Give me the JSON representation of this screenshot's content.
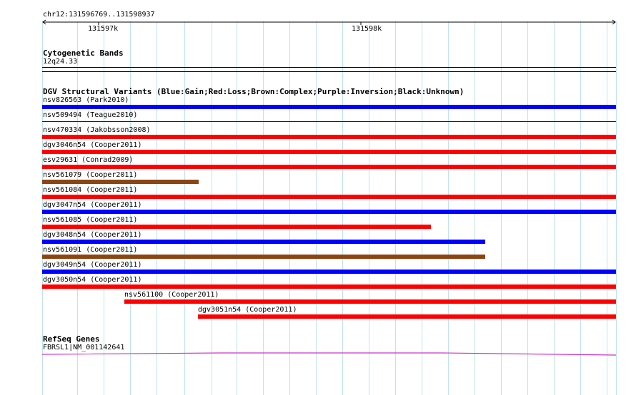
{
  "ruler": {
    "region": "chr12:131596769..131598937",
    "ticks": [
      "131597k",
      "131598k"
    ]
  },
  "cytoband": {
    "title": "Cytogenetic Bands",
    "band": "12q24.33"
  },
  "dgv": {
    "title": "DGV Structural Variants (Blue:Gain;Red:Loss;Brown:Complex;Purple:Inversion;Black:Unknown)",
    "colors": {
      "gain": "#0000ff",
      "loss": "#ff0000",
      "complex": "#8b4513"
    },
    "features": [
      {
        "label": "nsv826563 (Park2010)",
        "type": "gain"
      },
      {
        "label": "nsv509494 (Teague2010)",
        "type": "gain"
      },
      {
        "label": "nsv470334 (Jakobsson2008)",
        "type": "loss"
      },
      {
        "label": "dgv3046n54 (Cooper2011)",
        "type": "loss"
      },
      {
        "label": "esv29631 (Conrad2009)",
        "type": "loss"
      },
      {
        "label": "nsv561079 (Cooper2011)",
        "type": "complex"
      },
      {
        "label": "nsv561084 (Cooper2011)",
        "type": "loss"
      },
      {
        "label": "dgv3047n54 (Cooper2011)",
        "type": "gain"
      },
      {
        "label": "nsv561085 (Cooper2011)",
        "type": "loss"
      },
      {
        "label": "dgv3048n54 (Cooper2011)",
        "type": "gain"
      },
      {
        "label": "nsv561091 (Cooper2011)",
        "type": "complex"
      },
      {
        "label": "dgv3049n54 (Cooper2011)",
        "type": "gain"
      },
      {
        "label": "dgv3050n54 (Cooper2011)",
        "type": "loss"
      },
      {
        "label": "nsv561100 (Cooper2011)",
        "type": "loss"
      },
      {
        "label": "dgv3051n54 (Cooper2011)",
        "type": "loss"
      }
    ]
  },
  "refseq": {
    "title": "RefSeq Genes",
    "gene_label": "FBRSL1|NM_001142641",
    "color": "#cc33cc"
  }
}
